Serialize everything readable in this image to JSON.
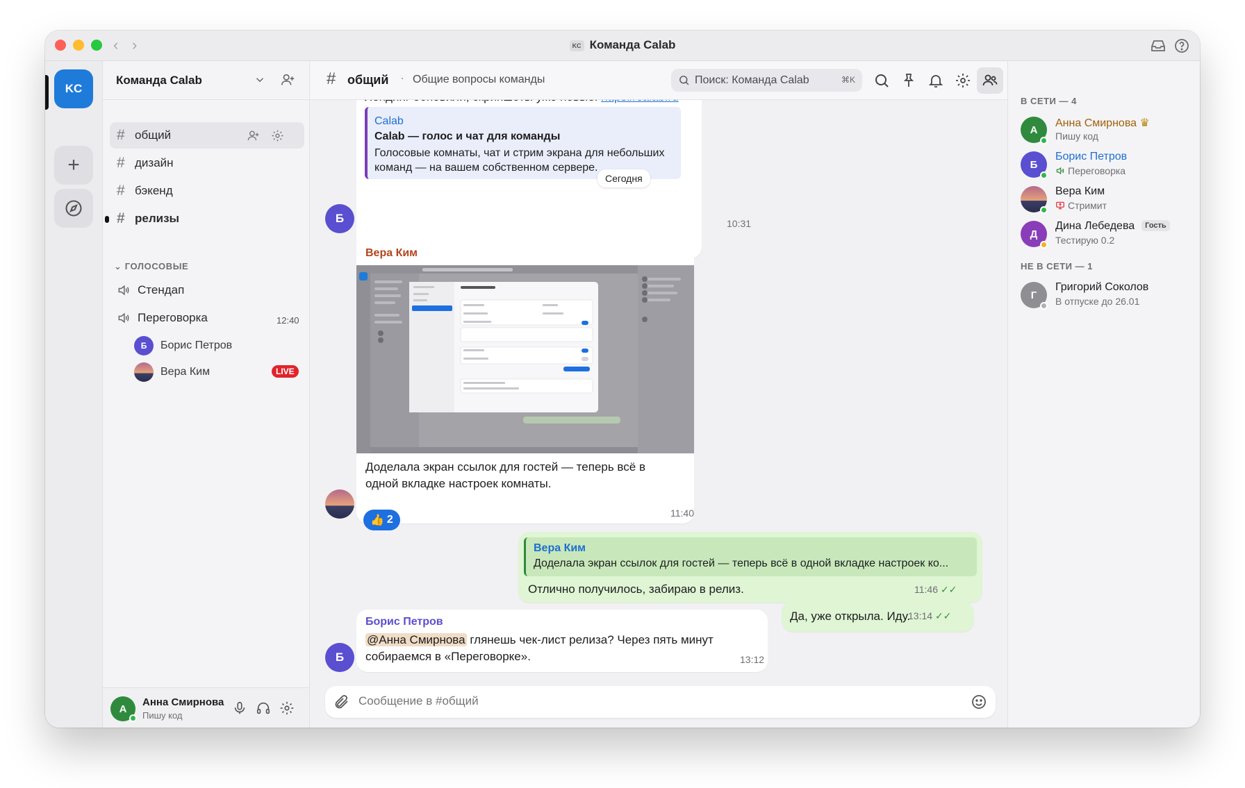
{
  "window": {
    "title": "Команда Calab",
    "title_badge": "KC"
  },
  "rail": {
    "server_initials": "KC"
  },
  "sidebar": {
    "team_name": "Команда Calab",
    "channels": [
      {
        "name": "общий"
      },
      {
        "name": "дизайн"
      },
      {
        "name": "бэкенд"
      },
      {
        "name": "релизы"
      }
    ],
    "voice_header": "голосовые",
    "voice_channels": [
      {
        "name": "Стендап"
      },
      {
        "name": "Переговорка",
        "time": "12:40"
      }
    ],
    "voice_users": [
      {
        "name": "Борис Петров",
        "initial": "Б"
      },
      {
        "name": "Вера Ким",
        "badge": "LIVE"
      }
    ],
    "user": {
      "initial": "А",
      "name": "Анна Смирнова",
      "status": "Пишу код"
    }
  },
  "header": {
    "channel": "общий",
    "topic": "Общие вопросы команды",
    "search_placeholder": "Поиск: Команда Calab",
    "search_shortcut": "⌘K"
  },
  "messages": [
    {
      "id": "m1",
      "avatar": "Б",
      "partial_text": "Лендинг обновили, скриншоты уже новые:",
      "partial_link": "https://calab.ru",
      "date_chip": "Сегодня",
      "link_preview": {
        "site": "Calab",
        "title": "Calab — голос и чат для команды",
        "description": "Голосовые комнаты, чат и стрим экрана для небольших команд — на вашем собственном сервере."
      },
      "time": "10:31"
    },
    {
      "id": "m2",
      "sender": "Вера Ким",
      "text": "Доделала экран ссылок для гостей — теперь всё в одной вкладке настроек комнаты.",
      "reaction": {
        "emoji": "👍",
        "count": "2"
      },
      "time": "11:40"
    },
    {
      "id": "m3",
      "reply_to": {
        "name": "Вера Ким",
        "text": "Доделала экран ссылок для гостей — теперь всё в одной вкладке настроек ко..."
      },
      "text": "Отлично получилось, забираю в релиз.",
      "time": "11:46"
    },
    {
      "id": "m4",
      "avatar": "Б",
      "sender": "Борис Петров",
      "mention": "@Анна Смирнова",
      "text_after_mention": " глянешь чек-лист релиза? Через пять минут собираемся в «Переговорке».",
      "time": "13:12"
    },
    {
      "id": "m5",
      "text": "Да, уже открыла. Иду.",
      "time": "13:14"
    }
  ],
  "composer": {
    "placeholder": "Сообщение в #общий"
  },
  "members": {
    "online_header": "В СЕТИ — 4",
    "offline_header": "НЕ В СЕТИ — 1",
    "online": [
      {
        "initial": "А",
        "name": "Анна Смирнова",
        "status": "Пишу код",
        "color": "#2f8a3d",
        "name_color": "#a0600a"
      },
      {
        "initial": "Б",
        "name": "Борис Петров",
        "status": "Переговорка",
        "color": "#5a4fd0",
        "name_color": "#1e6fd0"
      },
      {
        "name": "Вера Ким",
        "status": "Стримит",
        "name_color": "#1d1d1f"
      },
      {
        "initial": "Д",
        "name": "Дина Лебедева",
        "badge": "Гость",
        "status": "Тестирую 0.2",
        "color": "#8a3db8",
        "name_color": "#1d1d1f"
      }
    ],
    "offline": [
      {
        "initial": "Г",
        "name": "Григорий Соколов",
        "status": "В отпуске до 26.01",
        "color": "#8e8e93"
      }
    ]
  },
  "colors": {
    "accent": "#1e7bd9",
    "mine_bubble": "#dff5d4",
    "live": "#e0242b",
    "online": "#2fb84a",
    "away": "#f2b21b"
  }
}
